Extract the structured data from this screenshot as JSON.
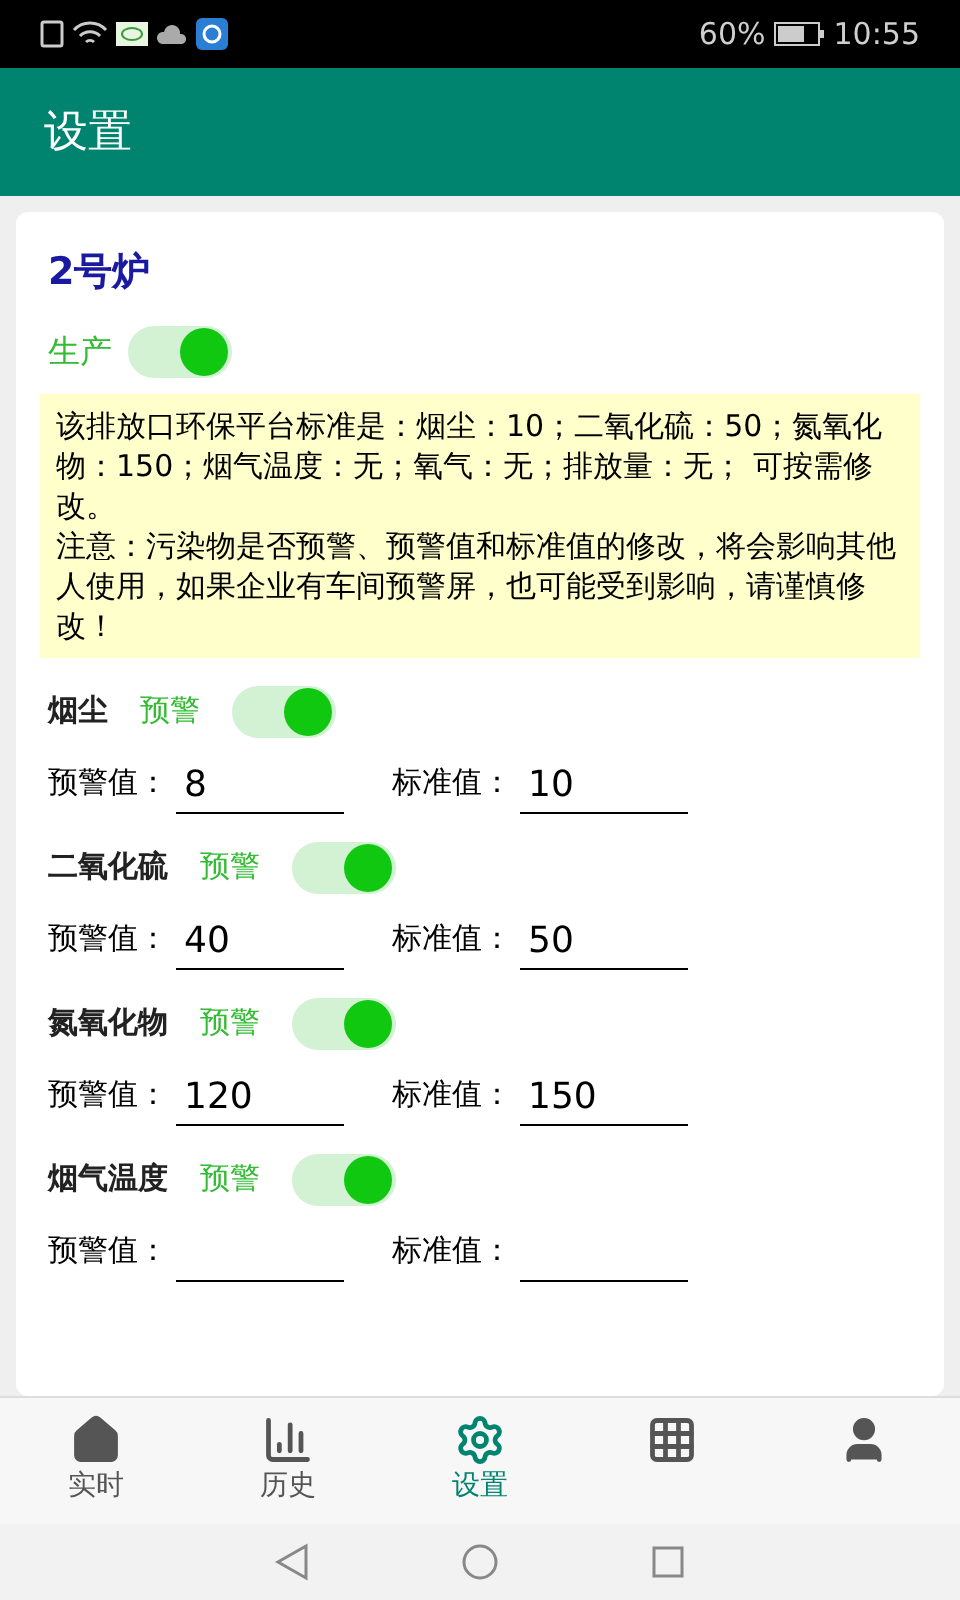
{
  "status_bar": {
    "battery": "60%",
    "time": "10:55"
  },
  "header": {
    "title": "设置"
  },
  "boiler": {
    "title": "2号炉",
    "production": {
      "label": "生产",
      "on": true
    },
    "notice": [
      "该排放口环保平台标准是：烟尘：10；二氧化硫：50；氮氧化物：150；烟气温度：无；氧气：无；排放量：无； 可按需修改。",
      "注意：污染物是否预警、预警值和标准值的修改，将会影响其他人使用，如果企业有车间预警屏，也可能受到影响，请谨慎修改！"
    ]
  },
  "pollutants": [
    {
      "name": "烟尘",
      "alarm_label": "预警",
      "alarm_on": true,
      "warn_label": "预警值：",
      "warn_value": "8",
      "std_label": "标准值：",
      "std_value": "10"
    },
    {
      "name": "二氧化硫",
      "alarm_label": "预警",
      "alarm_on": true,
      "warn_label": "预警值：",
      "warn_value": "40",
      "std_label": "标准值：",
      "std_value": "50"
    },
    {
      "name": "氮氧化物",
      "alarm_label": "预警",
      "alarm_on": true,
      "warn_label": "预警值：",
      "warn_value": "120",
      "std_label": "标准值：",
      "std_value": "150"
    },
    {
      "name": "烟气温度",
      "alarm_label": "预警",
      "alarm_on": true,
      "warn_label": "预警值：",
      "std_label": "标准值："
    }
  ],
  "tabs": [
    {
      "kind": "home",
      "label": "实时",
      "selected": false
    },
    {
      "kind": "chart",
      "label": "历史",
      "selected": false
    },
    {
      "kind": "gear",
      "label": "设置",
      "selected": true
    },
    {
      "kind": "grid",
      "selected": false
    },
    {
      "kind": "person",
      "selected": false
    }
  ]
}
